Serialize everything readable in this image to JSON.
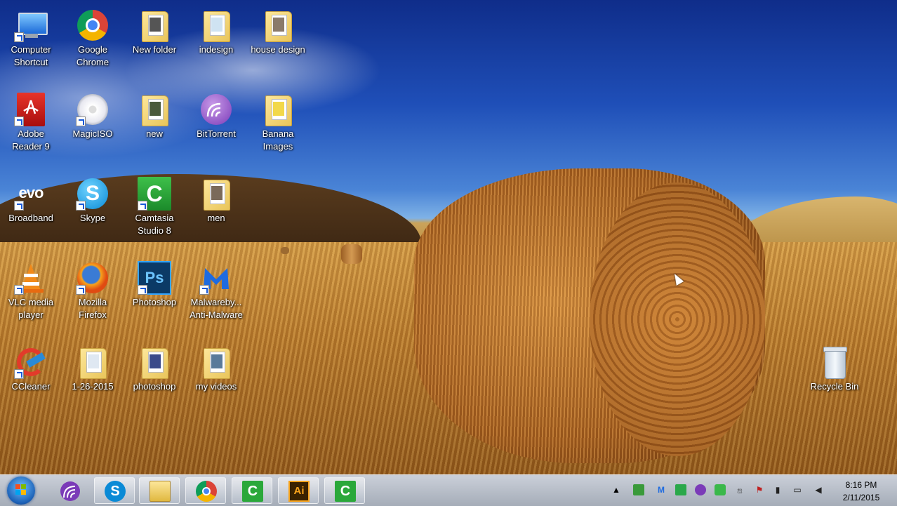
{
  "desktop": {
    "icons": [
      {
        "label_lines": [
          "Computer",
          "Shortcut"
        ],
        "icon": "computer-icon"
      },
      {
        "label_lines": [
          "Google",
          "Chrome"
        ],
        "icon": "chrome-icon"
      },
      {
        "label_lines": [
          "New folder"
        ],
        "icon": "folder-icon"
      },
      {
        "label_lines": [
          "indesign"
        ],
        "icon": "folder-icon"
      },
      {
        "label_lines": [
          "house design"
        ],
        "icon": "folder-icon"
      },
      {
        "label_lines": [
          "Adobe",
          "Reader 9"
        ],
        "icon": "adobe-reader-icon"
      },
      {
        "label_lines": [
          "MagicISO"
        ],
        "icon": "magiciso-icon"
      },
      {
        "label_lines": [
          "new"
        ],
        "icon": "folder-icon"
      },
      {
        "label_lines": [
          "BitTorrent"
        ],
        "icon": "bittorrent-icon"
      },
      {
        "label_lines": [
          "Banana",
          "Images"
        ],
        "icon": "folder-icon"
      },
      {
        "label_lines": [
          "Broadband"
        ],
        "icon": "evo-broadband-icon",
        "logo_text": "evo"
      },
      {
        "label_lines": [
          "Skype"
        ],
        "icon": "skype-icon"
      },
      {
        "label_lines": [
          "Camtasia",
          "Studio 8"
        ],
        "icon": "camtasia-icon"
      },
      {
        "label_lines": [
          "men"
        ],
        "icon": "folder-icon"
      },
      {
        "label_lines": [
          "VLC media",
          "player"
        ],
        "icon": "vlc-icon"
      },
      {
        "label_lines": [
          "Mozilla",
          "Firefox"
        ],
        "icon": "firefox-icon"
      },
      {
        "label_lines": [
          "Photoshop"
        ],
        "icon": "photoshop-icon",
        "logo_text": "Ps"
      },
      {
        "label_lines": [
          "Malwareby...",
          "Anti-Malware"
        ],
        "icon": "malwarebytes-icon"
      },
      {
        "label_lines": [
          "CCleaner"
        ],
        "icon": "ccleaner-icon"
      },
      {
        "label_lines": [
          "1-26-2015"
        ],
        "icon": "folder-icon"
      },
      {
        "label_lines": [
          "photoshop"
        ],
        "icon": "folder-icon"
      },
      {
        "label_lines": [
          "my videos"
        ],
        "icon": "folder-icon"
      },
      {
        "label_lines": [
          "Recycle Bin"
        ],
        "icon": "recycle-bin-icon"
      }
    ]
  },
  "taskbar": {
    "start_icon": "windows-start-icon",
    "pinned": [
      {
        "name": "bittorrent",
        "icon": "bittorrent-icon"
      },
      {
        "name": "skype",
        "icon": "skype-icon",
        "glyph": "S"
      },
      {
        "name": "windows-explorer",
        "icon": "folder-icon"
      },
      {
        "name": "google-chrome",
        "icon": "chrome-icon"
      },
      {
        "name": "camtasia-recorder",
        "icon": "camtasia-icon",
        "glyph": "C"
      },
      {
        "name": "adobe-illustrator",
        "icon": "illustrator-icon",
        "glyph": "Ai"
      },
      {
        "name": "camtasia-studio",
        "icon": "camtasia-icon",
        "glyph": "C"
      }
    ],
    "tray_icons": [
      "show-hidden-icons-arrow",
      "usb-icon",
      "malwarebytes-icon",
      "sync-icon",
      "bittorrent-icon",
      "security-icon",
      "language-icon",
      "action-center-flag-icon",
      "power-icon",
      "network-icon",
      "volume-icon"
    ],
    "clock": {
      "time": "8:16 PM",
      "date": "2/11/2015"
    },
    "colors": {
      "accent": "#1b5fb5"
    }
  }
}
